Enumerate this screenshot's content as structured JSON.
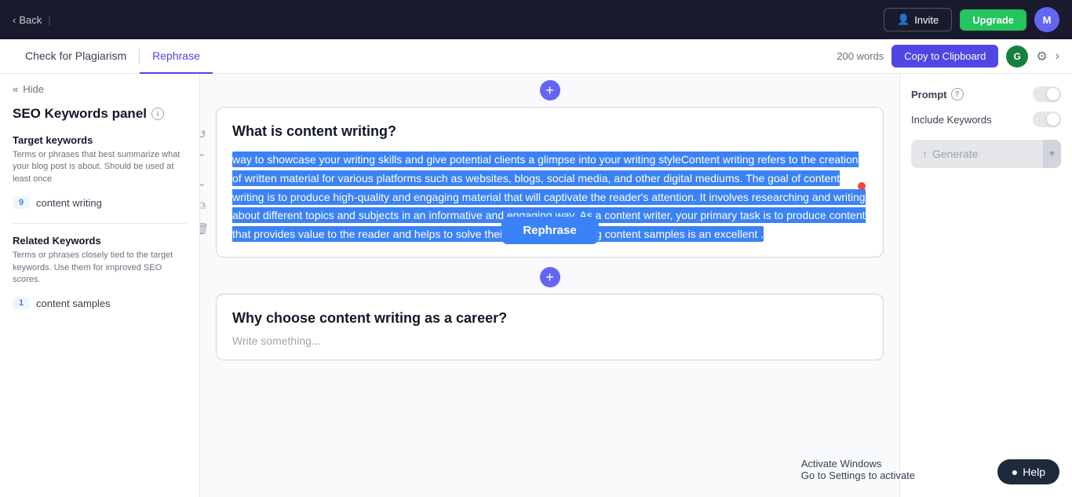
{
  "topNav": {
    "backLabel": "Back",
    "inviteLabel": "Invite",
    "upgradeLabel": "Upgrade",
    "avatarInitial": "M"
  },
  "secondaryNav": {
    "tabs": [
      {
        "label": "Check for Plagiarism",
        "active": false
      },
      {
        "label": "Rephrase",
        "active": true
      }
    ],
    "wordCount": "200 words",
    "copyLabel": "Copy to Clipboard"
  },
  "sidebar": {
    "hideLabel": "Hide",
    "title": "SEO Keywords panel",
    "targetKeywordsLabel": "Target keywords",
    "targetKeywordsDesc": "Terms or phrases that best summarize what your blog post is about. Should be used at least once",
    "targetKeywords": [
      {
        "count": "9",
        "text": "content writing"
      }
    ],
    "relatedKeywordsLabel": "Related Keywords",
    "relatedKeywordsDesc": "Terms or phrases closely tied to the target keywords. Use them for improved SEO scores.",
    "relatedKeywords": [
      {
        "count": "1",
        "text": "content samples"
      }
    ]
  },
  "contentBlock1": {
    "title": "What is content writing?",
    "selectedText": "way to showcase your writing skills and give potential clients a glimpse into your writing styleContent writing refers to the creation of written material for various platforms such as websites, blogs, social media, and other digital mediums. The goal of content writing is to produce high-quality and engaging material that will captivate the reader's attention. It involves researching and writing about different topics and subjects in an informative and engaging way. As a content writer, your primary task is to produce content that provides value to the reader and helps to solve their problems. Creating content samples is an excellent .",
    "rephraseLabel": "Rephrase"
  },
  "contentBlock2": {
    "title": "Why choose content writing as a career?",
    "placeholder": "Write something..."
  },
  "rightPanel": {
    "promptLabel": "Prompt",
    "includeKeywordsLabel": "Include Keywords",
    "generateLabel": "Generate"
  },
  "activateWindows": {
    "line1": "Activate Windows",
    "line2": "Go to Settings to activate"
  },
  "helpLabel": "Help"
}
